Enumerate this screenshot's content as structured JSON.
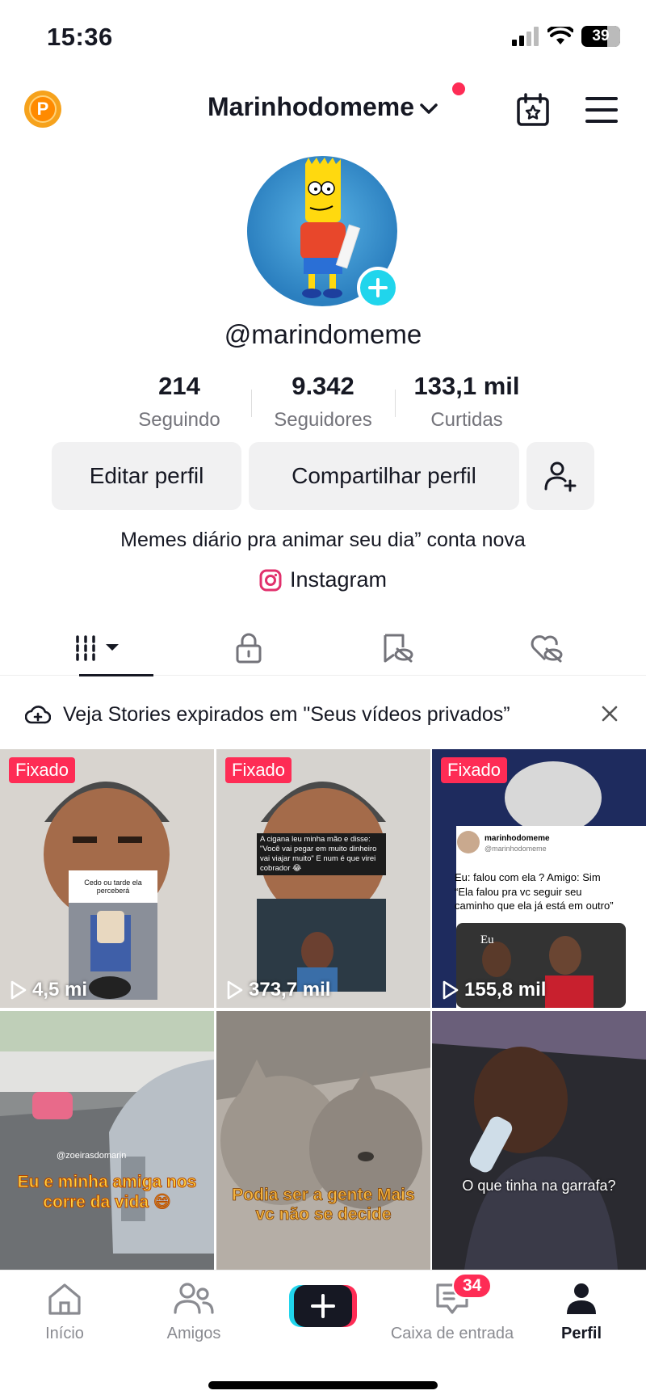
{
  "status": {
    "time": "15:36",
    "battery": "39"
  },
  "header": {
    "username": "Marinhodomeme",
    "points_letter": "P"
  },
  "profile": {
    "handle": "@marindomeme",
    "stats": [
      {
        "value": "214",
        "label": "Seguindo"
      },
      {
        "value": "9.342",
        "label": "Seguidores"
      },
      {
        "value": "133,1 mil",
        "label": "Curtidas"
      }
    ],
    "edit_label": "Editar perfil",
    "share_label": "Compartilhar perfil",
    "bio": "Memes diário pra animar seu dia” conta nova",
    "instagram_label": "Instagram"
  },
  "notice": {
    "text": "Veja Stories expirados em \"Seus vídeos privados”"
  },
  "videos": [
    {
      "pinned": "Fixado",
      "views": "4,5 mi",
      "caption": "Cedo ou tarde ela perceberá"
    },
    {
      "pinned": "Fixado",
      "views": "373,7 mil",
      "caption": "A cigana leu minha mão e disse: \"Você vai pegar em muito dinheiro vai viajar muito\" E num é que virei cobrador 😂"
    },
    {
      "pinned": "Fixado",
      "views": "155,8 mil",
      "post_name": "marinhodomeme",
      "post_handle": "@marinhodomeme",
      "post_text": "Eu: falou com ela ? Amigo: Sim “Ela falou pra vc seguir seu caminho que ela já está em outro”",
      "photo_label": "Eu"
    },
    {
      "caption": "Eu e minha amiga nos corre da vida 😄",
      "tag": "@zoeirasdomarin"
    },
    {
      "caption": "Podia ser a gente Mais vc não se decide"
    },
    {
      "caption": "O que tinha na garrafa?"
    }
  ],
  "nav": {
    "home": "Início",
    "friends": "Amigos",
    "inbox": "Caixa de entrada",
    "inbox_badge": "34",
    "profile": "Perfil"
  },
  "colors": {
    "accent": "#fe2c55",
    "cyan": "#20d5ec"
  }
}
